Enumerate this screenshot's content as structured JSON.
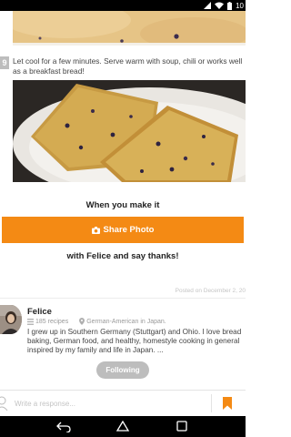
{
  "status_bar": {
    "time": "10",
    "icons": [
      "wifi-icon",
      "signal-icon",
      "battery-icon"
    ]
  },
  "step": {
    "number": "9",
    "text": "Let cool for a few minutes. Serve warm with soup, chili or works well as a breakfast bread!"
  },
  "cooksnap": {
    "title": "When you make it",
    "share_label": "Share Photo",
    "share_icon": "camera-icon",
    "thanks_text": "with Felice and say thanks!"
  },
  "posted_text": "Posted on December 2, 20",
  "author": {
    "name": "Felice",
    "recipes": "185 recipes",
    "location": "German-American in Japan.",
    "bio": "I grew up in Southern Germany (Stuttgart) and Ohio. I love bread baking, German food, and healthy, homestyle cooking in general inspired by my family and life in Japan. ...",
    "follow_label": "Following"
  },
  "reply": {
    "placeholder": "Write a response..."
  },
  "colors": {
    "accent": "#f48a14",
    "follow_bg": "#bdbdbd"
  }
}
